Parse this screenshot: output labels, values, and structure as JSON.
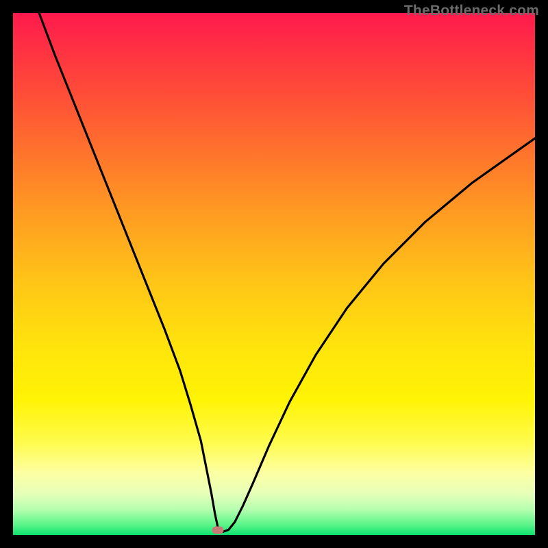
{
  "watermark": "TheBottleneck.com",
  "chart_data": {
    "type": "line",
    "title": "",
    "xlabel": "",
    "ylabel": "",
    "xlim": [
      0,
      100
    ],
    "ylim": [
      0,
      100
    ],
    "grid": false,
    "legend": false,
    "series": [
      {
        "name": "curve",
        "color": "#000000",
        "x": [
          5,
          8,
          11,
          14,
          17,
          20,
          23,
          26,
          29,
          32,
          34,
          36,
          37,
          38,
          38.7,
          39.3,
          40.2,
          41.3,
          42.5,
          44,
          46,
          49,
          53,
          58,
          64,
          71,
          79,
          88,
          100
        ],
        "y": [
          100,
          92,
          84.5,
          77,
          69.5,
          62,
          54.5,
          47,
          39.5,
          31.5,
          25,
          18,
          13,
          8,
          4,
          1.2,
          0.6,
          1.0,
          2.5,
          5.5,
          10,
          17,
          25.5,
          34.5,
          43.5,
          52,
          60,
          67.5,
          76
        ]
      }
    ],
    "marker": {
      "x": 39.2,
      "y": 0.9,
      "color": "#c77b74"
    },
    "background_gradient": {
      "top": "#ff1a4d",
      "mid": "#ffe40c",
      "bottom": "#0de26e"
    }
  }
}
